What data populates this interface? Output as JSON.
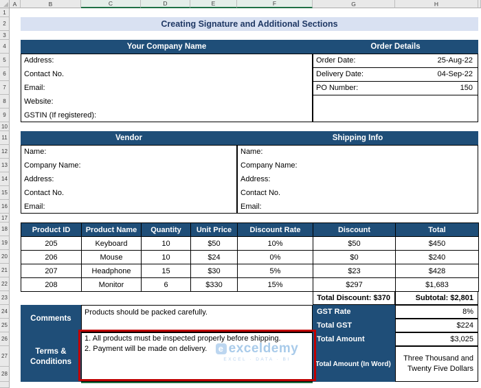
{
  "sheet": {
    "columns": [
      "A",
      "B",
      "C",
      "D",
      "E",
      "F",
      "G",
      "H"
    ],
    "rows": [
      "1",
      "2",
      "3",
      "4",
      "5",
      "6",
      "7",
      "8",
      "9",
      "10",
      "11",
      "12",
      "13",
      "14",
      "15",
      "16",
      "17",
      "18",
      "19",
      "20",
      "21",
      "22",
      "23",
      "24",
      "25",
      "26",
      "27",
      "28"
    ]
  },
  "title": {
    "text": "Creating Signature and Additional Sections"
  },
  "company": {
    "header": "Your Company Name",
    "fields": [
      "Address:",
      "Contact No.",
      "Email:",
      "Website:",
      "GSTIN (If registered):"
    ]
  },
  "order_details": {
    "header": "Order Details",
    "rows": [
      {
        "label": "Order Date:",
        "value": "25-Aug-22"
      },
      {
        "label": "Delivery Date:",
        "value": "04-Sep-22"
      },
      {
        "label": "PO Number:",
        "value": "150"
      }
    ]
  },
  "vendor": {
    "header": "Vendor",
    "fields": [
      "Name:",
      "Company Name:",
      "Address:",
      "Contact No.",
      "Email:"
    ]
  },
  "shipping": {
    "header": "Shipping Info",
    "fields": [
      "Name:",
      "Company Name:",
      "Address:",
      "Contact No.",
      "Email:"
    ]
  },
  "products": {
    "headers": [
      "Product ID",
      "Product Name",
      "Quantity",
      "Unit Price",
      "Discount Rate",
      "Discount",
      "Total"
    ],
    "rows": [
      [
        "205",
        "Keyboard",
        "10",
        "$50",
        "10%",
        "$50",
        "$450"
      ],
      [
        "206",
        "Mouse",
        "10",
        "$24",
        "0%",
        "$0",
        "$240"
      ],
      [
        "207",
        "Headphone",
        "15",
        "$30",
        "5%",
        "$23",
        "$428"
      ],
      [
        "208",
        "Monitor",
        "6",
        "$330",
        "15%",
        "$297",
        "$1,683"
      ]
    ],
    "total_discount": "Total Discount: $370",
    "subtotal": "Subtotal: $2,801"
  },
  "comments": {
    "label": "Comments",
    "text": "Products should be packed carefully."
  },
  "terms": {
    "label": "Terms & Conditions",
    "lines": [
      "1. All products must be inspected properly before shipping.",
      "2. Payment will be made on delivery."
    ]
  },
  "totals": {
    "gst_rate_label": "GST Rate",
    "gst_rate_value": "8%",
    "total_gst_label": "Total GST",
    "total_gst_value": "$224",
    "total_amount_label": "Total Amount",
    "total_amount_value": "$3,025",
    "in_words_label": "Total Amount (In Word)",
    "in_words_value": "Three Thousand and Twenty Five Dollars"
  },
  "watermark": {
    "brand": "exceldemy",
    "tagline": "EXCEL · DATA · BI"
  },
  "colors": {
    "section_header_bg": "#1F4E78",
    "title_bg": "#D9E1F2",
    "annotation_red": "#C00000",
    "selection_green": "#1E7145"
  }
}
